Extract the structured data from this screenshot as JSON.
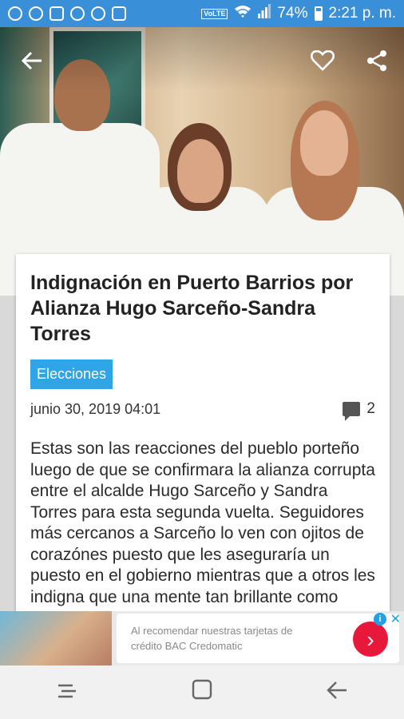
{
  "status_bar": {
    "battery": "74%",
    "time": "2:21 p. m.",
    "network": "VoLTE"
  },
  "hero": {
    "back_icon": "arrow-left-icon",
    "favorite_icon": "heart-outline-icon",
    "share_icon": "share-icon"
  },
  "article": {
    "title": "Indignación en Puerto Barrios por Alianza Hugo Sarceño-Sandra Torres",
    "category": "Elecciones",
    "date": "junio 30, 2019 04:01",
    "comment_count": "2",
    "body": "Estas son las reacciones del pueblo porteño luego de que se confirmara la alianza corrupta entre el alcalde Hugo Sarceño y Sandra Torres para esta segunda vuelta. Seguidores más cercanos a Sarceño lo ven con ojitos de corazónes puesto que les aseguraría un puesto en el gobierno mientras que a otros les indigna que una mente tan brillante como Hugo"
  },
  "ad": {
    "text_line1": "Al recomendar nuestras tarjetas de",
    "text_line2": "crédito BAC Credomatic",
    "info": "i",
    "close": "✕"
  },
  "colors": {
    "status_bar": "#3a8fd9",
    "tag": "#2fa4e7",
    "ad_button": "#e8183a"
  }
}
